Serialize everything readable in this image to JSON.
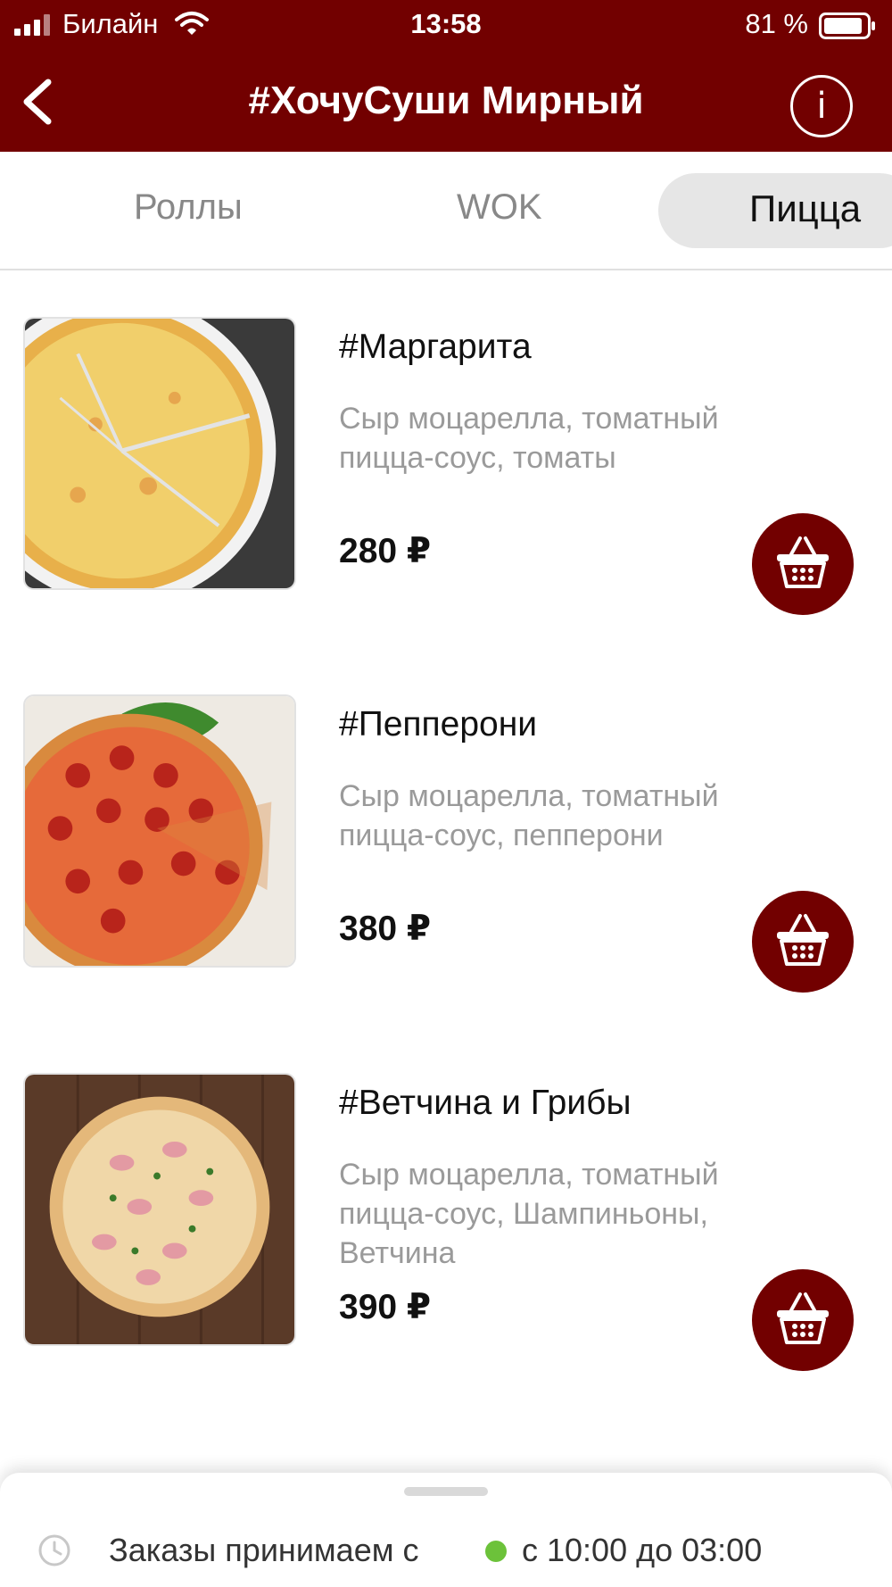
{
  "status_bar": {
    "carrier": "Билайн",
    "time": "13:58",
    "battery": "81 %"
  },
  "header": {
    "title": "#ХочуСуши Мирный",
    "info_label": "i"
  },
  "tabs": [
    {
      "label": "Роллы",
      "active": false
    },
    {
      "label": "WOK",
      "active": false
    },
    {
      "label": "Пицца",
      "active": true
    }
  ],
  "products": [
    {
      "name": "#Маргарита",
      "description": "Сыр моцарелла, томатный пицца-соус, томаты",
      "price": "280 ₽"
    },
    {
      "name": "#Пепперони",
      "description": "Сыр моцарелла, томатный пицца-соус, пепперони",
      "price": "380 ₽"
    },
    {
      "name": "#Ветчина и Грибы",
      "description": "Сыр моцарелла, томатный пицца-соус, Шампиньоны, Ветчина",
      "price": "390 ₽"
    }
  ],
  "footer": {
    "label": "Заказы принимаем с",
    "hours": "с 10:00 до 03:00"
  },
  "colors": {
    "brand": "#720000",
    "open_status": "#6cc23a"
  },
  "icons": [
    "signal-icon",
    "wifi-icon",
    "battery-icon",
    "back-chevron-icon",
    "info-icon",
    "basket-icon",
    "clock-icon"
  ]
}
